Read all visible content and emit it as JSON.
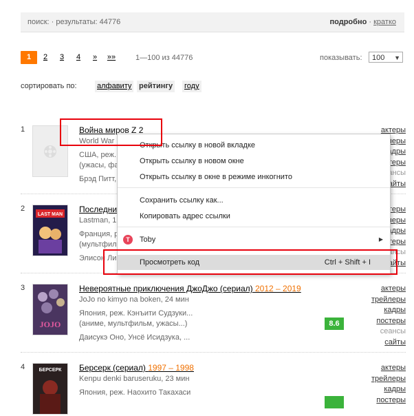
{
  "topbar": {
    "search_text": "поиск:  ·  результаты: 44776",
    "detailed": "подробно",
    "dot": " · ",
    "brief": "кратко"
  },
  "pager": {
    "pages": [
      "1",
      "2",
      "3",
      "4",
      "»",
      "»»"
    ],
    "range": "1—100 из 44776",
    "show_label": "показывать:",
    "show_value": "100"
  },
  "sort": {
    "label": "сортировать по:",
    "options": [
      "алфавиту",
      "рейтингу",
      "году"
    ]
  },
  "films": [
    {
      "num": "1",
      "title": "Война миров Z 2",
      "years": "",
      "orig": "World War",
      "info1": "США, реж.",
      "info2": "(ужасы, фа",
      "cast": "Брэд Питт, ",
      "side": [
        "актеры",
        "трейлеры",
        "кадры",
        "постеры",
        "сеансы",
        "сайты"
      ]
    },
    {
      "num": "2",
      "title": "Последни",
      "years": "",
      "orig": "Lastman, 1",
      "info1": "Франция, р",
      "info2": "(мультфил",
      "cast": "Элисон Ли",
      "side": [
        "актеры",
        "трейлеры",
        "кадры",
        "постеры",
        "сеансы",
        "сайты"
      ]
    },
    {
      "num": "3",
      "title": "Невероятные приключения ДжоДжо (сериал)",
      "years": "2012 – 2019",
      "orig": "JoJo no kimyo na boken, 24 мин",
      "info1": "Япония, реж. Кэнъити Судзуки...",
      "info2": "(аниме, мультфильм, ужасы...)",
      "cast": "Даисукэ Оно, Унсё Исидзука, ...",
      "rating": "8.6",
      "side": [
        "актеры",
        "трейлеры",
        "кадры",
        "постеры",
        "сеансы",
        "сайты"
      ]
    },
    {
      "num": "4",
      "title": "Берсерк (сериал)",
      "years": "1997 – 1998",
      "orig": "Kenpu denki baruseruku, 23 мин",
      "info1": "Япония, реж. Наохито Такахаси",
      "side": [
        "актеры",
        "трейлеры",
        "кадры",
        "постеры"
      ]
    }
  ],
  "context_menu": {
    "items": [
      "Открыть ссылку в новой вкладке",
      "Открыть ссылку в новом окне",
      "Открыть ссылку в окне в режиме инкогнито",
      "Сохранить ссылку как...",
      "Копировать адрес ссылки",
      "Toby",
      "Просмотреть код"
    ],
    "inspect_shortcut": "Ctrl + Shift + I",
    "toby_glyph": "T"
  },
  "poster_labels": {
    "p2": "LAST MAN",
    "p3": "JOJO",
    "p4": "БЕРСЕРК"
  },
  "colors": {
    "accent": "#ff7800",
    "rating_green": "#3bb33b",
    "year_orange": "#f07000",
    "highlight_red": "#e8000b"
  }
}
